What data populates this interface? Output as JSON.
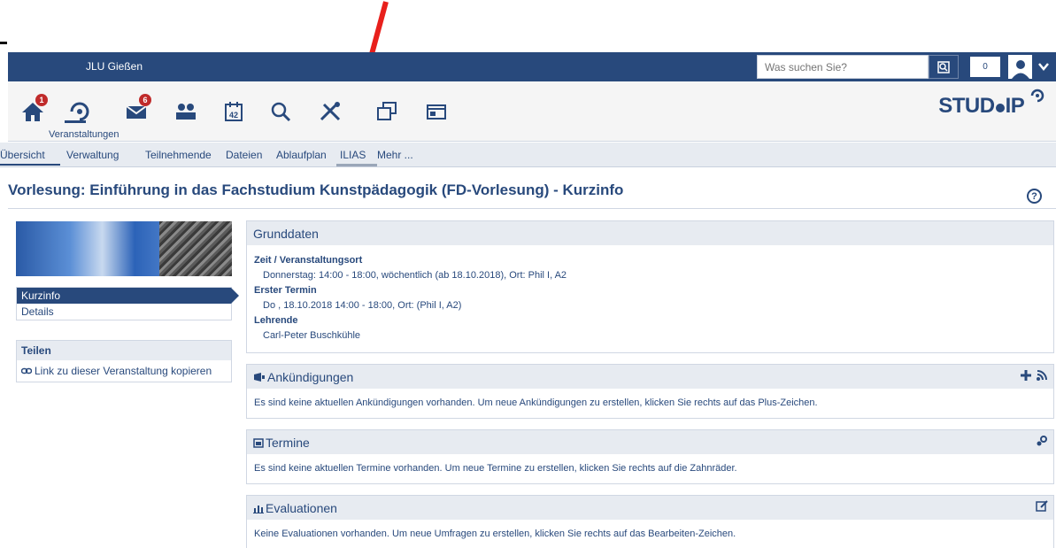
{
  "topbar": {
    "university": "JLU Gießen",
    "search_placeholder": "Was suchen Sie?",
    "notification_count": "0"
  },
  "navbar": {
    "active_label": "Veranstaltungen",
    "badges": {
      "start": "1",
      "messages": "6"
    }
  },
  "logo": {
    "text_main": "STUD",
    "text_suffix": "IP"
  },
  "tabs": [
    {
      "label": "Übersicht"
    },
    {
      "label": "Verwaltung"
    },
    {
      "label": "Teilnehmende"
    },
    {
      "label": "Dateien"
    },
    {
      "label": "Ablaufplan"
    },
    {
      "label": "ILIAS"
    },
    {
      "label": "Mehr ..."
    }
  ],
  "page": {
    "title": "Vorlesung: Einführung in das Fachstudium Kunstpädagogik (FD-Vorlesung) - Kurzinfo"
  },
  "sidebar": {
    "nav": [
      {
        "label": "Kurzinfo"
      },
      {
        "label": "Details"
      }
    ],
    "share_heading": "Teilen",
    "share_link": "Link zu dieser Veranstaltung kopieren"
  },
  "grunddaten": {
    "heading": "Grunddaten",
    "time_location_label": "Zeit / Veranstaltungsort",
    "time_location_value": "Donnerstag: 14:00 - 18:00, wöchentlich (ab 18.10.2018), Ort: Phil I, A2",
    "first_date_label": "Erster Termin",
    "first_date_value": "Do , 18.10.2018 14:00 - 18:00, Ort: (Phil I, A2)",
    "teachers_label": "Lehrende",
    "teachers_value": "Carl-Peter Buschkühle"
  },
  "announcements": {
    "heading": "Ankündigungen",
    "text": "Es sind keine aktuellen Ankündigungen vorhanden. Um neue Ankündigungen zu erstellen, klicken Sie rechts auf das Plus-Zeichen."
  },
  "appointments": {
    "heading": "Termine",
    "text": "Es sind keine aktuellen Termine vorhanden. Um neue Termine zu erstellen, klicken Sie rechts auf die Zahnräder."
  },
  "evaluations": {
    "heading": "Evaluationen",
    "text": "Keine Evaluationen vorhanden. Um neue Umfragen zu erstellen, klicken Sie rechts auf das Bearbeiten-Zeichen."
  },
  "colors": {
    "brand": "#28497c",
    "badge": "#c02b2b",
    "arrow": "#e8201c",
    "header_bg": "#e7ebf1"
  }
}
